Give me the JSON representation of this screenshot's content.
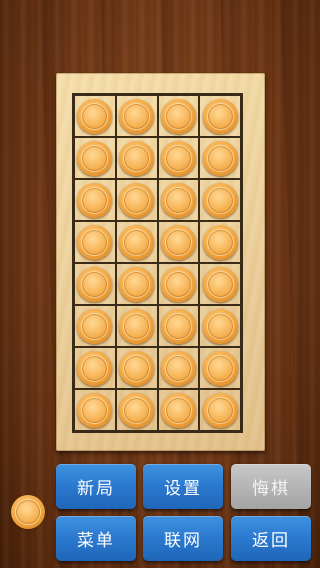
{
  "game": {
    "rows": 8,
    "cols": 4,
    "pieces_per_cell": true,
    "piece_color": "#f6b253",
    "current_turn_piece": "orange-piece"
  },
  "buttons": {
    "new_game": "新局",
    "settings": "设置",
    "undo": "悔棋",
    "menu": "菜单",
    "network": "联网",
    "back": "返回"
  },
  "colors": {
    "button_blue": "#2a79cf",
    "button_disabled": "#b5b5b5",
    "board_light": "#ecd09a",
    "wood_dark": "#6e3716"
  }
}
